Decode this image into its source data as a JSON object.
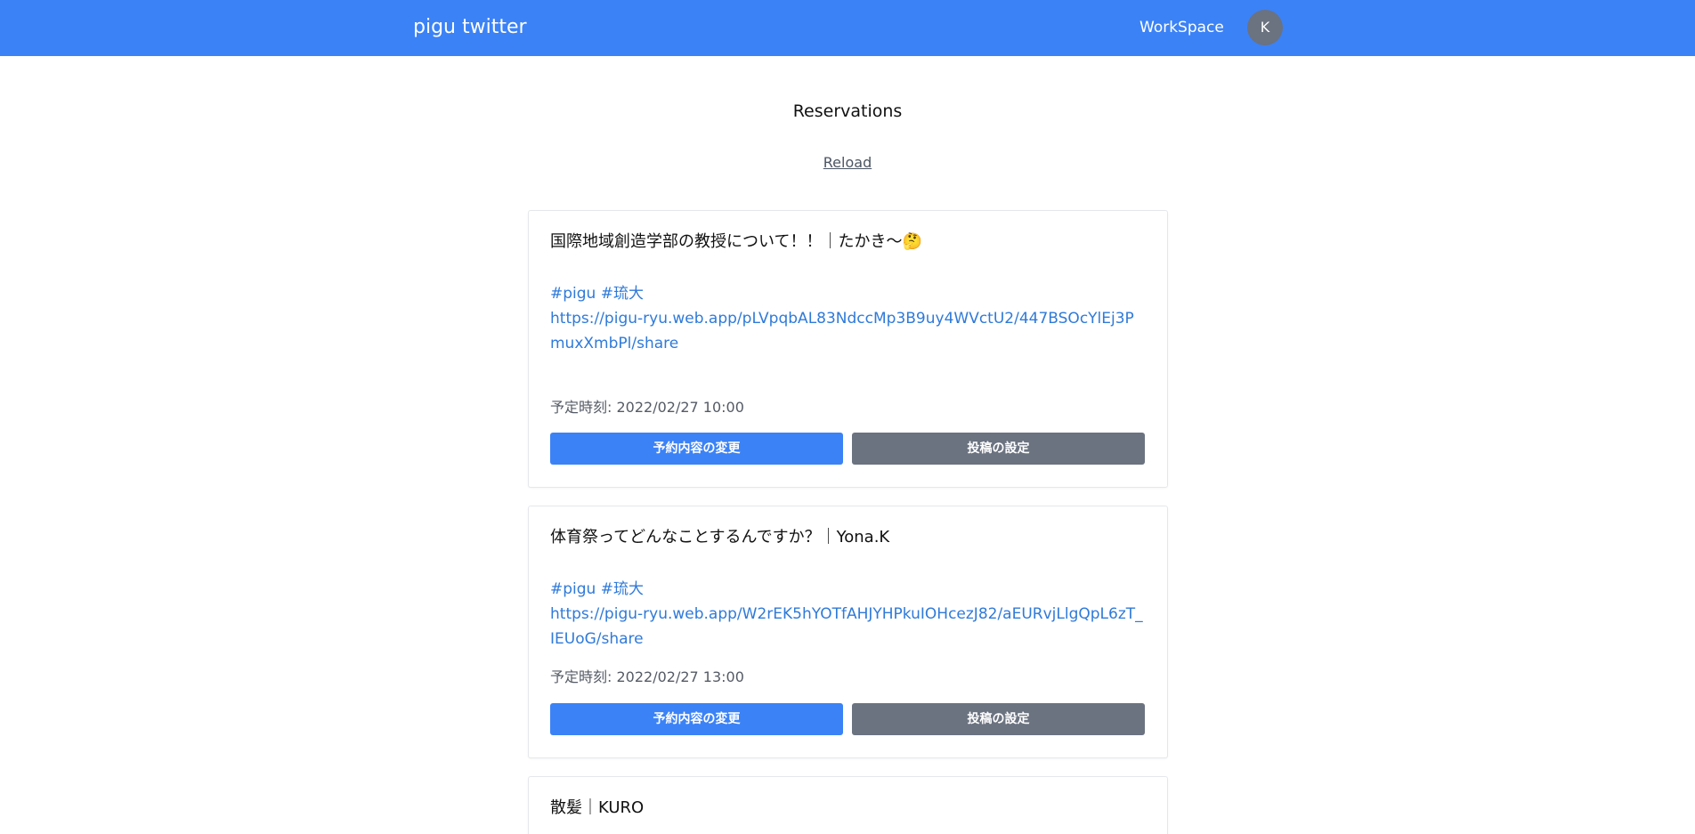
{
  "header": {
    "brand": "pigu twitter",
    "workspace_label": "WorkSpace",
    "avatar_initial": "K"
  },
  "page": {
    "title": "Reservations",
    "reload_label": "Reload"
  },
  "reservations": [
    {
      "title": "国際地域創造学部の教授について！！｜たかき〜🤔",
      "tags": "#pigu #琉大",
      "url": "https://pigu-ryu.web.app/pLVpqbAL83NdccMp3B9uy4WVctU2/447BSOcYlEj3PmuxXmbPl/share",
      "scheduled": "予定時刻: 2022/02/27 10:00",
      "edit_label": "予約内容の変更",
      "settings_label": "投稿の設定"
    },
    {
      "title": "体育祭ってどんなことするんですか？｜Yona.K",
      "tags": "#pigu #琉大",
      "url": "https://pigu-ryu.web.app/W2rEK5hYOTfAHJYHPkuIOHcezJ82/aEURvjLlgQpL6zT_IEUoG/share",
      "scheduled": "予定時刻: 2022/02/27 13:00",
      "edit_label": "予約内容の変更",
      "settings_label": "投稿の設定"
    },
    {
      "title": "散髪｜KURO"
    }
  ]
}
